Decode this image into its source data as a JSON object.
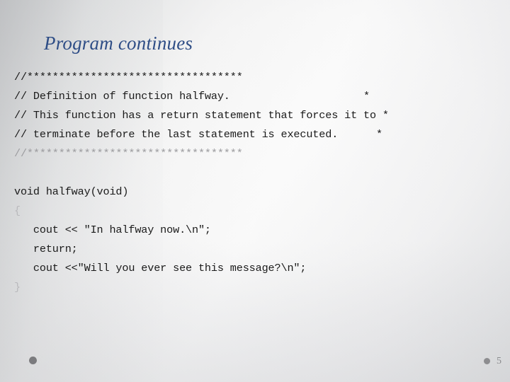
{
  "slide": {
    "title": "Program continues",
    "page_number": "5",
    "accent_color": "#2e4d86",
    "code_color": "#1a1a1a",
    "dim_color": "#9d9da0",
    "brace_color": "#b9b9bc",
    "background_color": "#f5f5f6"
  },
  "code": {
    "language": "cpp",
    "lines": [
      {
        "text": "//**********************************",
        "style": "normal"
      },
      {
        "text": "// Definition of function halfway.                     *",
        "style": "normal"
      },
      {
        "text": "// This function has a return statement that forces it to *",
        "style": "normal"
      },
      {
        "text": "// terminate before the last statement is executed.      *",
        "style": "normal"
      },
      {
        "text": "//**********************************",
        "style": "dim"
      },
      {
        "text": "",
        "style": "blank"
      },
      {
        "text": "void halfway(void)",
        "style": "normal"
      },
      {
        "text": "{",
        "style": "brace"
      },
      {
        "text": "   cout << \"In halfway now.\\n\";",
        "style": "normal"
      },
      {
        "text": "   return;",
        "style": "normal"
      },
      {
        "text": "   cout <<\"Will you ever see this message?\\n\";",
        "style": "normal"
      },
      {
        "text": "}",
        "style": "brace"
      }
    ]
  },
  "footer": {
    "left_bullet_icon": "circle-bullet-icon",
    "right_bullet_icon": "circle-bullet-icon"
  }
}
